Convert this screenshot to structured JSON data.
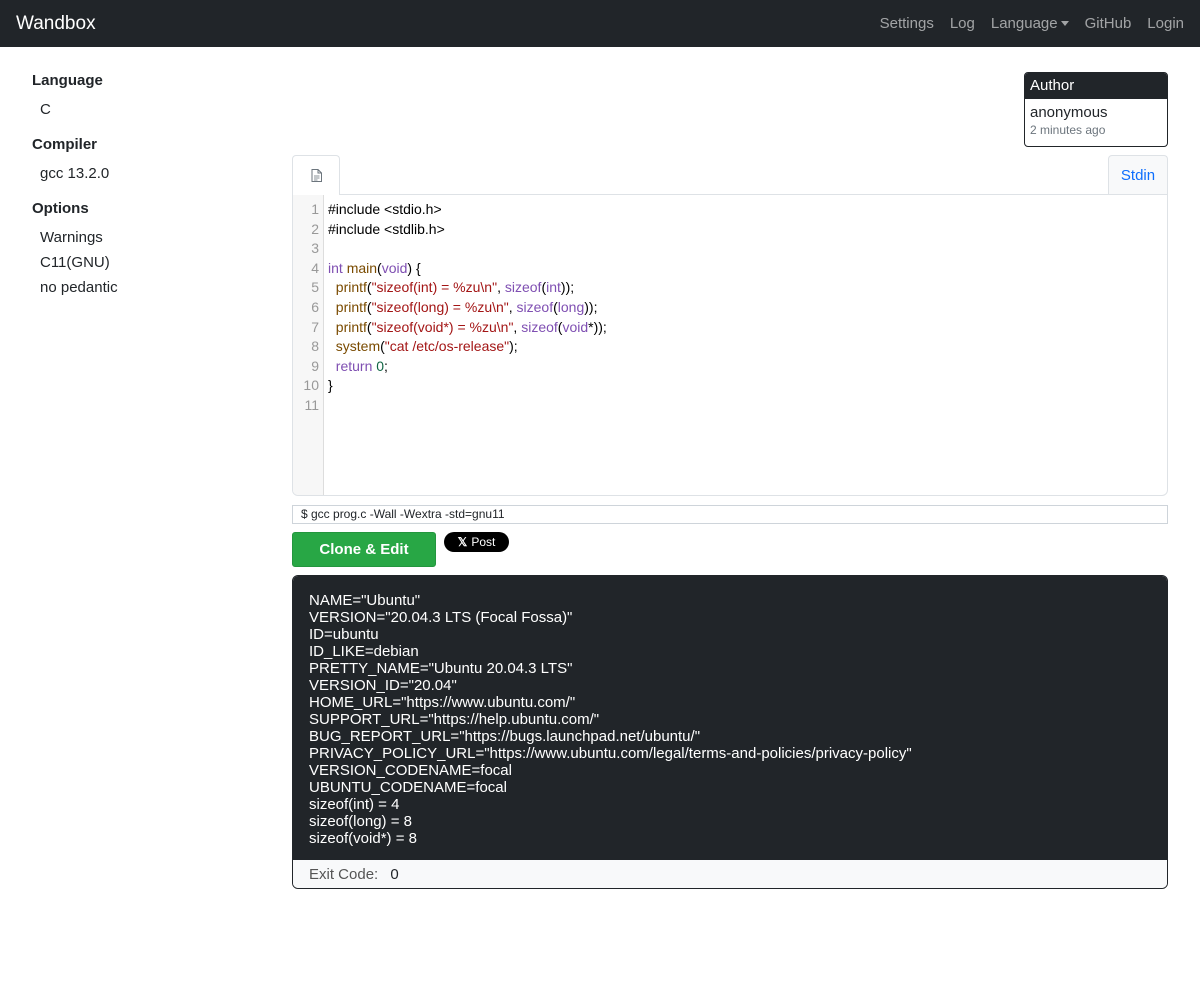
{
  "navbar": {
    "brand": "Wandbox",
    "links": {
      "settings": "Settings",
      "log": "Log",
      "language": "Language",
      "github": "GitHub",
      "login": "Login"
    }
  },
  "sidebar": {
    "language_heading": "Language",
    "language_value": "C",
    "compiler_heading": "Compiler",
    "compiler_value": "gcc 13.2.0",
    "options_heading": "Options",
    "options": [
      "Warnings",
      "C11(GNU)",
      "no pedantic"
    ]
  },
  "author": {
    "heading": "Author",
    "name": "anonymous",
    "time": "2 minutes ago"
  },
  "editor": {
    "file_tab_icon": "file-icon",
    "stdin_tab": "Stdin",
    "line_numbers": [
      "1",
      "2",
      "3",
      "4",
      "5",
      "6",
      "7",
      "8",
      "9",
      "10",
      "11"
    ],
    "code_lines": [
      "#include <stdio.h>",
      "#include <stdlib.h>",
      "",
      "int main(void) {",
      "  printf(\"sizeof(int) = %zu\\n\", sizeof(int));",
      "  printf(\"sizeof(long) = %zu\\n\", sizeof(long));",
      "  printf(\"sizeof(void*) = %zu\\n\", sizeof(void*));",
      "  system(\"cat /etc/os-release\");",
      "  return 0;",
      "}",
      ""
    ]
  },
  "command_line": "$ gcc prog.c -Wall -Wextra -std=gnu11",
  "actions": {
    "clone_edit": "Clone & Edit",
    "x_post_logo": "𝕏",
    "x_post": "Post"
  },
  "output": {
    "lines": [
      "NAME=\"Ubuntu\"",
      "VERSION=\"20.04.3 LTS (Focal Fossa)\"",
      "ID=ubuntu",
      "ID_LIKE=debian",
      "PRETTY_NAME=\"Ubuntu 20.04.3 LTS\"",
      "VERSION_ID=\"20.04\"",
      "HOME_URL=\"https://www.ubuntu.com/\"",
      "SUPPORT_URL=\"https://help.ubuntu.com/\"",
      "BUG_REPORT_URL=\"https://bugs.launchpad.net/ubuntu/\"",
      "PRIVACY_POLICY_URL=\"https://www.ubuntu.com/legal/terms-and-policies/privacy-policy\"",
      "VERSION_CODENAME=focal",
      "UBUNTU_CODENAME=focal",
      "sizeof(int) = 4",
      "sizeof(long) = 8",
      "sizeof(void*) = 8"
    ],
    "exit_label": "Exit Code:",
    "exit_value": "0"
  },
  "colors": {
    "navbar_bg": "#212529",
    "clone_button": "#28a745",
    "stdin_link": "#0d6efd"
  }
}
